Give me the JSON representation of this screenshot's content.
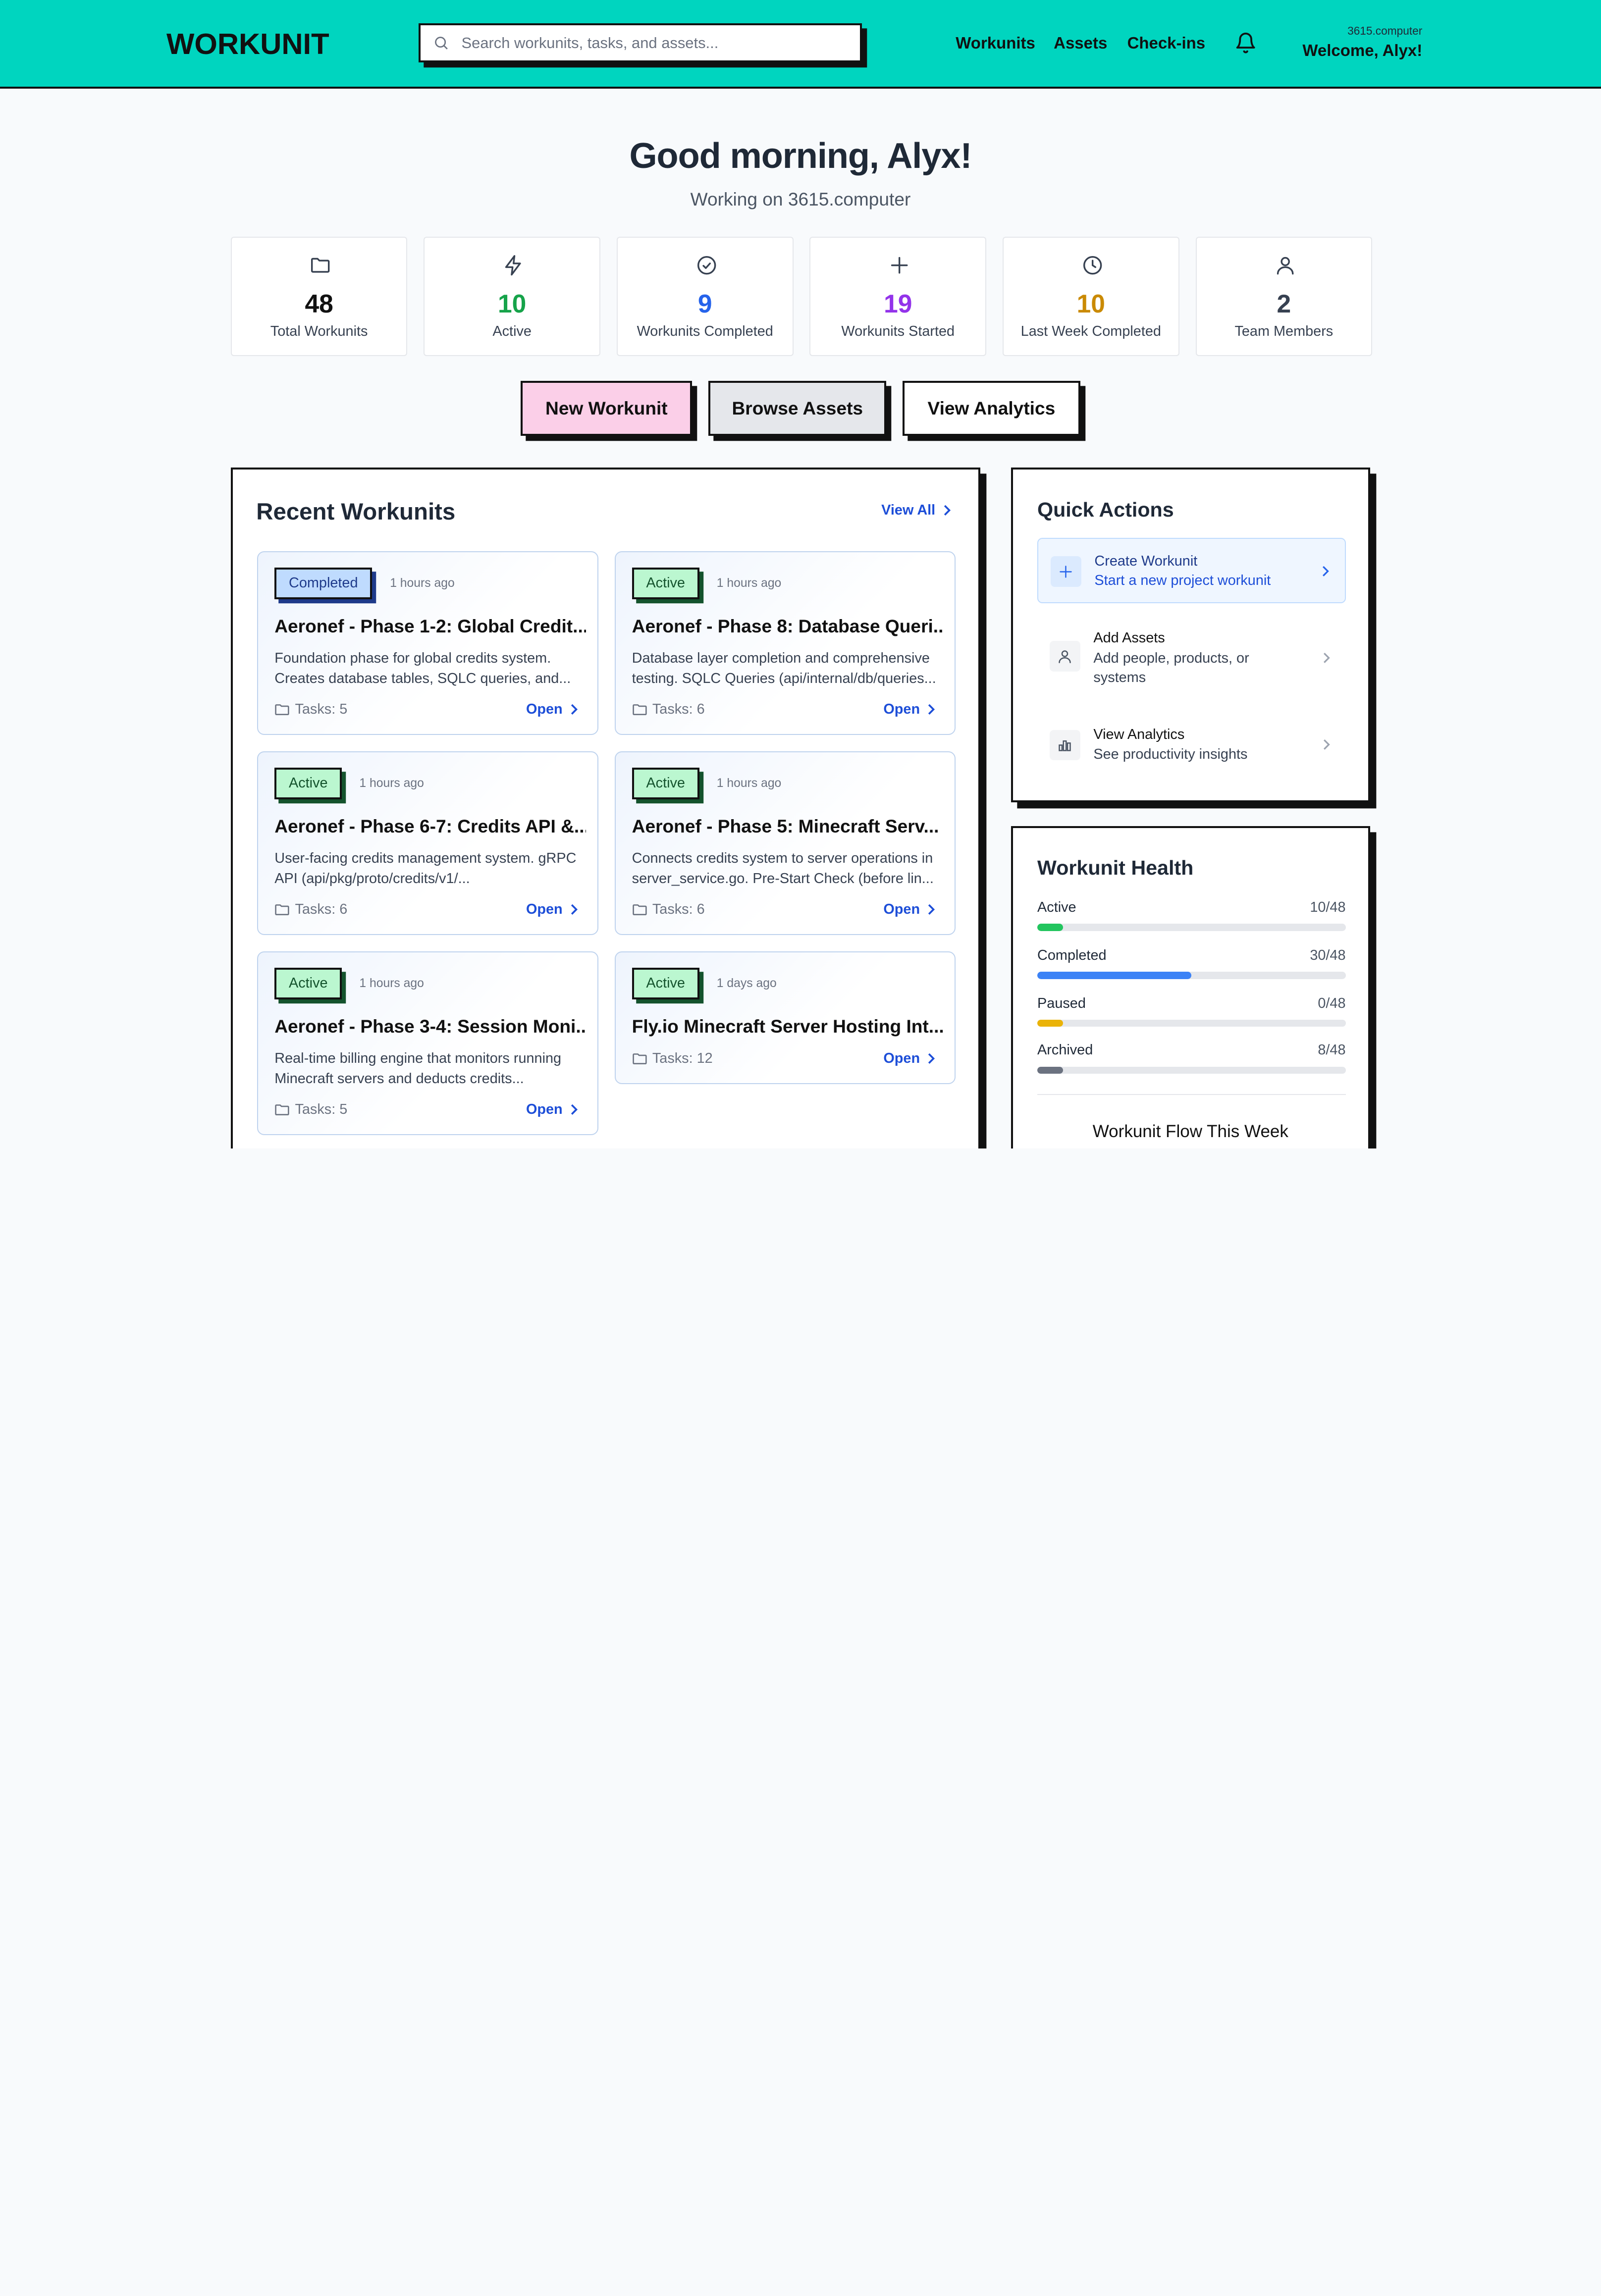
{
  "header": {
    "logo": "WORKUNIT",
    "search_placeholder": "Search workunits, tasks, and assets...",
    "nav": [
      "Workunits",
      "Assets",
      "Check-ins"
    ],
    "org": "3615.computer",
    "welcome": "Welcome, Alyx!"
  },
  "greeting": {
    "title": "Good morning, Alyx!",
    "subtitle": "Working on 3615.computer"
  },
  "stats": [
    {
      "value": "48",
      "label": "Total Workunits",
      "icon": "folder-icon",
      "color": "#111111"
    },
    {
      "value": "10",
      "label": "Active",
      "icon": "bolt-icon",
      "color": "#16a34a"
    },
    {
      "value": "9",
      "label": "Workunits Completed",
      "icon": "check-circle-icon",
      "color": "#2563eb"
    },
    {
      "value": "19",
      "label": "Workunits Started",
      "icon": "plus-icon",
      "color": "#9333ea"
    },
    {
      "value": "10",
      "label": "Last Week Completed",
      "icon": "clock-icon",
      "color": "#ca8a04"
    },
    {
      "value": "2",
      "label": "Team Members",
      "icon": "user-icon",
      "color": "#374151"
    }
  ],
  "actions": [
    {
      "label": "New Workunit",
      "bg": "#fbcfe8"
    },
    {
      "label": "Browse Assets",
      "bg": "#e5e7eb"
    },
    {
      "label": "View Analytics",
      "bg": "#ffffff"
    }
  ],
  "recent": {
    "title": "Recent Workunits",
    "view_all": "View All",
    "open_label": "Open",
    "cards": [
      {
        "status": "Completed",
        "time": "1 hours ago",
        "title": "Aeronef - Phase 1-2: Global Credit...",
        "desc": [
          "Foundation phase for global credits system.",
          "Creates database tables, SQLC queries, and..."
        ],
        "tasks": "Tasks: 5"
      },
      {
        "status": "Active",
        "time": "1 hours ago",
        "title": "Aeronef - Phase 8: Database Queri...",
        "desc": [
          "Database layer completion and comprehensive",
          "testing. SQLC Queries (api/internal/db/queries..."
        ],
        "tasks": "Tasks: 6"
      },
      {
        "status": "Active",
        "time": "1 hours ago",
        "title": "Aeronef - Phase 6-7: Credits API &...",
        "desc": [
          "User-facing credits management system. gRPC",
          "API (api/pkg/proto/credits/v1/..."
        ],
        "tasks": "Tasks: 6"
      },
      {
        "status": "Active",
        "time": "1 hours ago",
        "title": "Aeronef - Phase 5: Minecraft Serv...",
        "desc": [
          "Connects credits system to server operations in",
          "server_service.go. Pre-Start Check (before lin..."
        ],
        "tasks": "Tasks: 6"
      },
      {
        "status": "Active",
        "time": "1 hours ago",
        "title": "Aeronef - Phase 3-4: Session Moni...",
        "desc": [
          "Real-time billing engine that monitors running",
          "Minecraft servers and deducts credits..."
        ],
        "tasks": "Tasks: 5"
      },
      {
        "status": "Active",
        "time": "1 days ago",
        "title": "Fly.io Minecraft Server Hosting Int...",
        "desc": [],
        "tasks": "Tasks: 12"
      }
    ]
  },
  "quick_actions": {
    "title": "Quick Actions",
    "items": [
      {
        "title": "Create Workunit",
        "desc": "Start a new project workunit",
        "icon": "plus-icon"
      },
      {
        "title": "Add Assets",
        "desc": [
          "Add people, products, or",
          "systems"
        ],
        "icon": "user-icon"
      },
      {
        "title": "View Analytics",
        "desc": "See productivity insights",
        "icon": "bar-chart-icon"
      }
    ]
  },
  "health": {
    "title": "Workunit Health",
    "rows": [
      {
        "label": "Active",
        "value": "10/48",
        "fraction": 0.083,
        "color": "#22c55e"
      },
      {
        "label": "Completed",
        "value": "30/48",
        "fraction": 0.5,
        "color": "#3b82f6"
      },
      {
        "label": "Paused",
        "value": "0/48",
        "fraction": 0.083,
        "color": "#eab308"
      },
      {
        "label": "Archived",
        "value": "8/48",
        "fraction": 0.083,
        "color": "#6b7280"
      }
    ],
    "flow_title": "Workunit Flow This Week"
  }
}
